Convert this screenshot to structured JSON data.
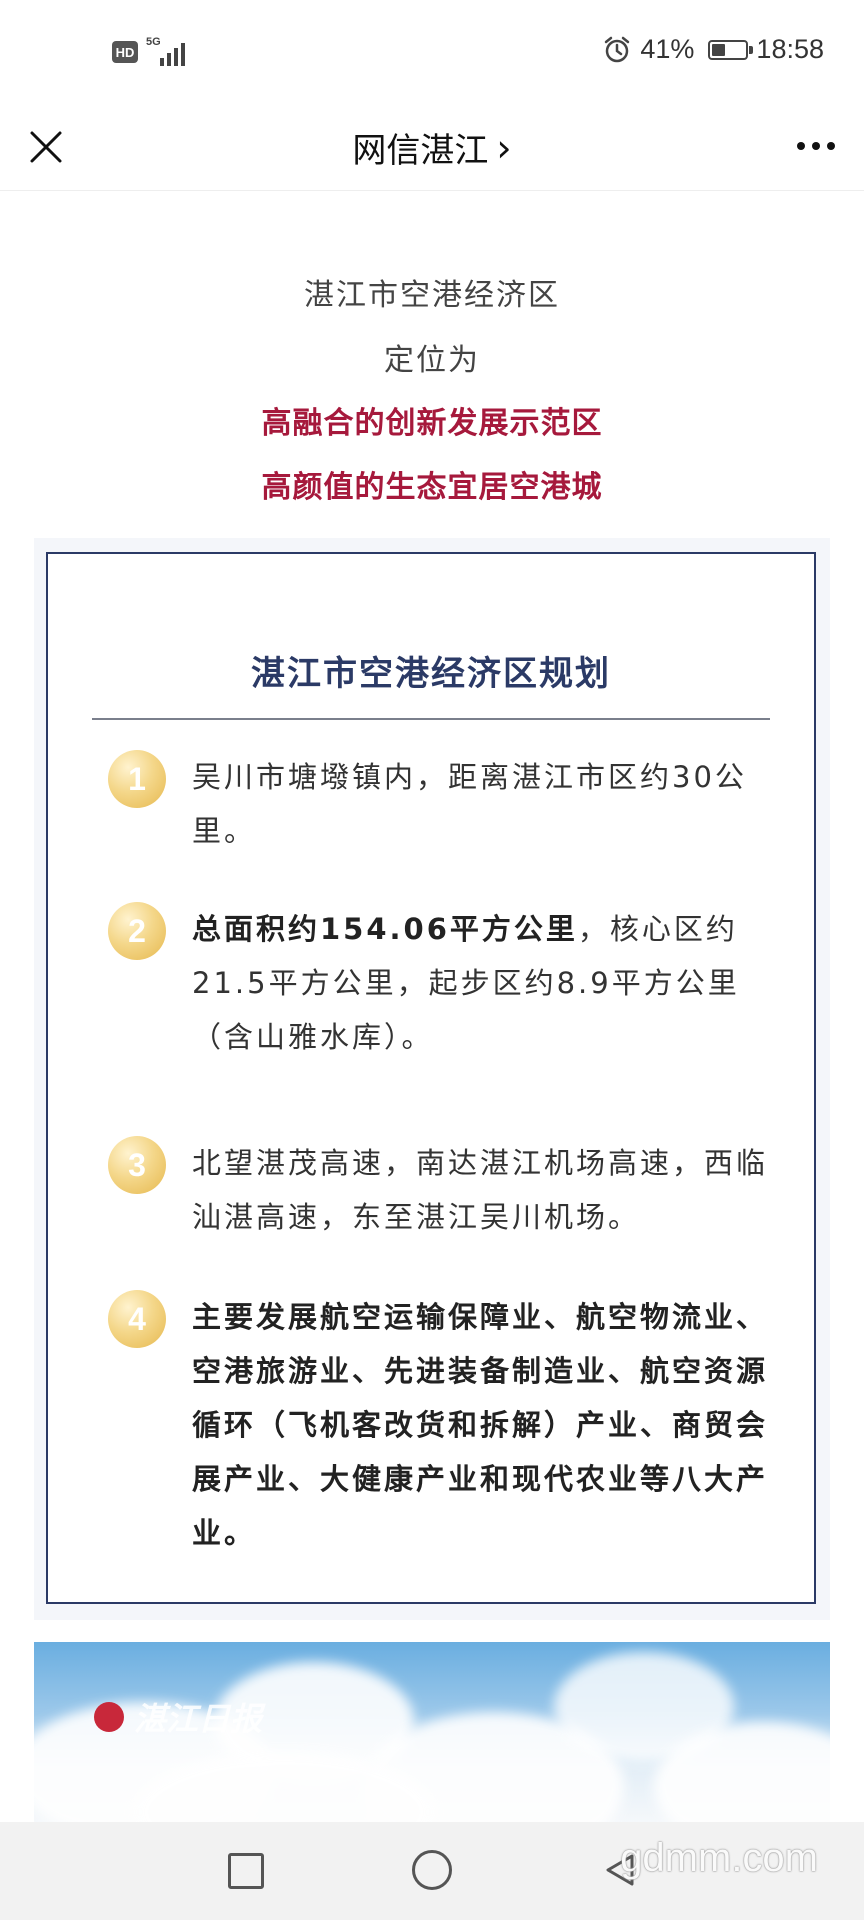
{
  "status_bar": {
    "hd": "HD",
    "network": "5G",
    "battery_text": "41%",
    "battery_level": 0.41,
    "time": "18:58"
  },
  "nav": {
    "title": "网信湛江",
    "chevron": "›"
  },
  "intro": {
    "line1": "湛江市空港经济区",
    "line2": "定位为",
    "highlight1": "高融合的创新发展示范区",
    "highlight2": "高颜值的生态宜居空港城"
  },
  "plan": {
    "title": "湛江市空港经济区规划",
    "items": [
      {
        "num": "1",
        "bold": "",
        "text": "吴川市塘墢镇内，距离湛江市区约30公里。"
      },
      {
        "num": "2",
        "bold": "总面积约154.06平方公里",
        "text": "，核心区约21.5平方公里，起步区约8.9平方公里（含山雅水库）。"
      },
      {
        "num": "3",
        "bold": "",
        "text": "北望湛茂高速，南达湛江机场高速，西临汕湛高速，东至湛江吴川机场。"
      },
      {
        "num": "4",
        "bold": "主要发展航空运输保障业、航空物流业、空港旅游业、先进装备制造业、航空资源循环（飞机客改货和拆解）产业、商贸会展产业、大健康产业和现代农业等八大产业。",
        "text": ""
      }
    ]
  },
  "image": {
    "logo_text": "湛江日报"
  },
  "watermark": "gdmm.com",
  "colors": {
    "accent_red": "#a6193c",
    "navy": "#2b3a66",
    "gold": "#e6b84e"
  },
  "icons": {
    "close": "close-icon",
    "more": "more-icon",
    "alarm": "alarm-icon",
    "battery": "battery-icon",
    "recent": "square-icon",
    "home": "circle-icon",
    "back": "triangle-back-icon"
  }
}
